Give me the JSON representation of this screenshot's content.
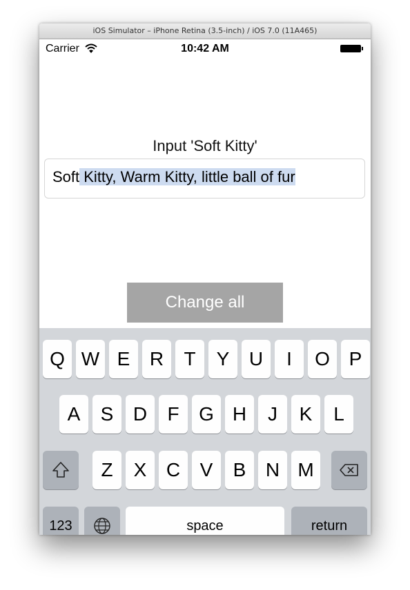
{
  "window": {
    "title": "iOS Simulator – iPhone Retina (3.5-inch) / iOS 7.0 (11A465)"
  },
  "status_bar": {
    "carrier": "Carrier",
    "time": "10:42 AM",
    "icons": [
      "wifi-icon",
      "battery-icon"
    ]
  },
  "main": {
    "prompt": "Input 'Soft Kitty'",
    "text_field": {
      "value_before_selection": "Soft",
      "value_selected": " Kitty, Warm Kitty, little ball of fur"
    },
    "button_label": "Change all"
  },
  "keyboard": {
    "row1": [
      "Q",
      "W",
      "E",
      "R",
      "T",
      "Y",
      "U",
      "I",
      "O",
      "P"
    ],
    "row2": [
      "A",
      "S",
      "D",
      "F",
      "G",
      "H",
      "J",
      "K",
      "L"
    ],
    "row3": [
      "Z",
      "X",
      "C",
      "V",
      "B",
      "N",
      "M"
    ],
    "numbers_label": "123",
    "space_label": "space",
    "return_label": "return",
    "icons": [
      "shift-icon",
      "delete-icon",
      "globe-icon"
    ]
  },
  "colors": {
    "button_bg": "#a5a5a5",
    "selection": "#cddbf0",
    "keyboard_bg": "#d3d6da"
  }
}
